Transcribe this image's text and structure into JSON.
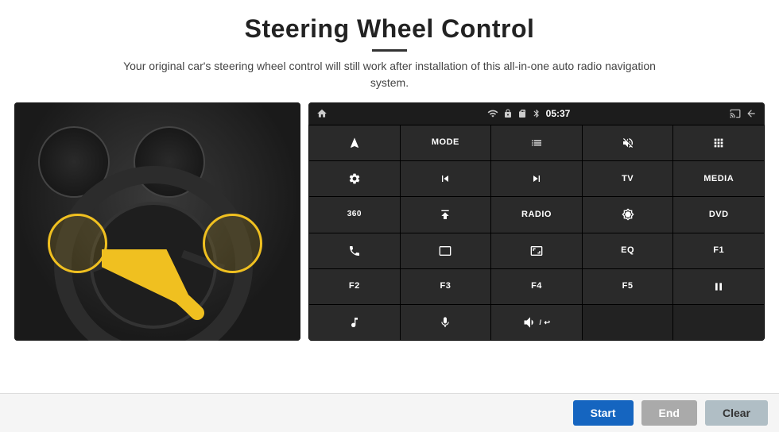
{
  "header": {
    "title": "Steering Wheel Control",
    "description": "Your original car's steering wheel control will still work after installation of this all-in-one auto radio navigation system."
  },
  "status_bar": {
    "time": "05:37",
    "wifi_icon": "wifi",
    "lock_icon": "lock",
    "sd_icon": "sd",
    "bt_icon": "bt",
    "home_icon": "home",
    "back_icon": "back",
    "cast_icon": "cast"
  },
  "buttons": [
    {
      "id": "r1c1",
      "type": "icon",
      "label": "navigate"
    },
    {
      "id": "r1c2",
      "type": "text",
      "label": "MODE"
    },
    {
      "id": "r1c3",
      "type": "icon",
      "label": "list"
    },
    {
      "id": "r1c4",
      "type": "icon",
      "label": "mute"
    },
    {
      "id": "r1c5",
      "type": "icon",
      "label": "apps"
    },
    {
      "id": "r2c1",
      "type": "icon",
      "label": "settings"
    },
    {
      "id": "r2c2",
      "type": "icon",
      "label": "prev"
    },
    {
      "id": "r2c3",
      "type": "icon",
      "label": "next"
    },
    {
      "id": "r2c4",
      "type": "text",
      "label": "TV"
    },
    {
      "id": "r2c5",
      "type": "text",
      "label": "MEDIA"
    },
    {
      "id": "r3c1",
      "type": "text",
      "label": "360"
    },
    {
      "id": "r3c2",
      "type": "icon",
      "label": "eject"
    },
    {
      "id": "r3c3",
      "type": "text",
      "label": "RADIO"
    },
    {
      "id": "r3c4",
      "type": "icon",
      "label": "brightness"
    },
    {
      "id": "r3c5",
      "type": "text",
      "label": "DVD"
    },
    {
      "id": "r4c1",
      "type": "icon",
      "label": "phone"
    },
    {
      "id": "r4c2",
      "type": "icon",
      "label": "screen"
    },
    {
      "id": "r4c3",
      "type": "icon",
      "label": "resize"
    },
    {
      "id": "r4c4",
      "type": "text",
      "label": "EQ"
    },
    {
      "id": "r4c5",
      "type": "text",
      "label": "F1"
    },
    {
      "id": "r5c1",
      "type": "text",
      "label": "F2"
    },
    {
      "id": "r5c2",
      "type": "text",
      "label": "F3"
    },
    {
      "id": "r5c3",
      "type": "text",
      "label": "F4"
    },
    {
      "id": "r5c4",
      "type": "text",
      "label": "F5"
    },
    {
      "id": "r5c5",
      "type": "icon",
      "label": "playpause"
    },
    {
      "id": "r6c1",
      "type": "icon",
      "label": "music"
    },
    {
      "id": "r6c2",
      "type": "icon",
      "label": "microphone"
    },
    {
      "id": "r6c3",
      "type": "icon",
      "label": "volphone"
    },
    {
      "id": "r6c4",
      "type": "empty",
      "label": ""
    },
    {
      "id": "r6c5",
      "type": "empty",
      "label": ""
    }
  ],
  "footer": {
    "start_label": "Start",
    "end_label": "End",
    "clear_label": "Clear"
  }
}
